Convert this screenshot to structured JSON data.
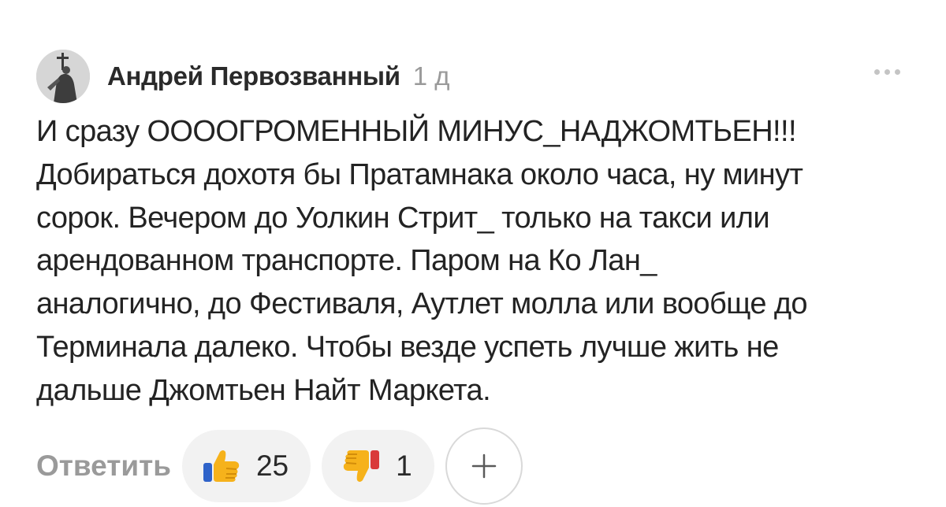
{
  "comment": {
    "author": "Андрей Первозванный",
    "time": "1 д",
    "text": "И сразу ООООГРОМЕННЫЙ МИНУС_НАДЖОМТЬЕН!!!\nДобираться дохотя бы Пратамнака около часа, ну минут\nсорок. Вечером до Уолкин Стрит_ только на такси или\nарендованном транспорте. Паром на Ко Лан_\nаналогично, до Фестиваля, Аутлет молла или вообще до\nТерминала далеко. Чтобы везде успеть лучше жить не\nдальше Джомтьен Найт Маркета."
  },
  "actions": {
    "reply_label": "Ответить",
    "likes": "25",
    "dislikes": "1"
  },
  "icons": {
    "avatar": "statue-avatar",
    "more": "more-dots-icon",
    "like": "thumbs-up-emoji",
    "dislike": "thumbs-down-emoji",
    "add_reaction": "plus-icon"
  },
  "colors": {
    "text": "#232323",
    "secondary": "#9a9a9a",
    "pill_background": "#f2f2f2",
    "emoji_yellow": "#f6b21b"
  }
}
